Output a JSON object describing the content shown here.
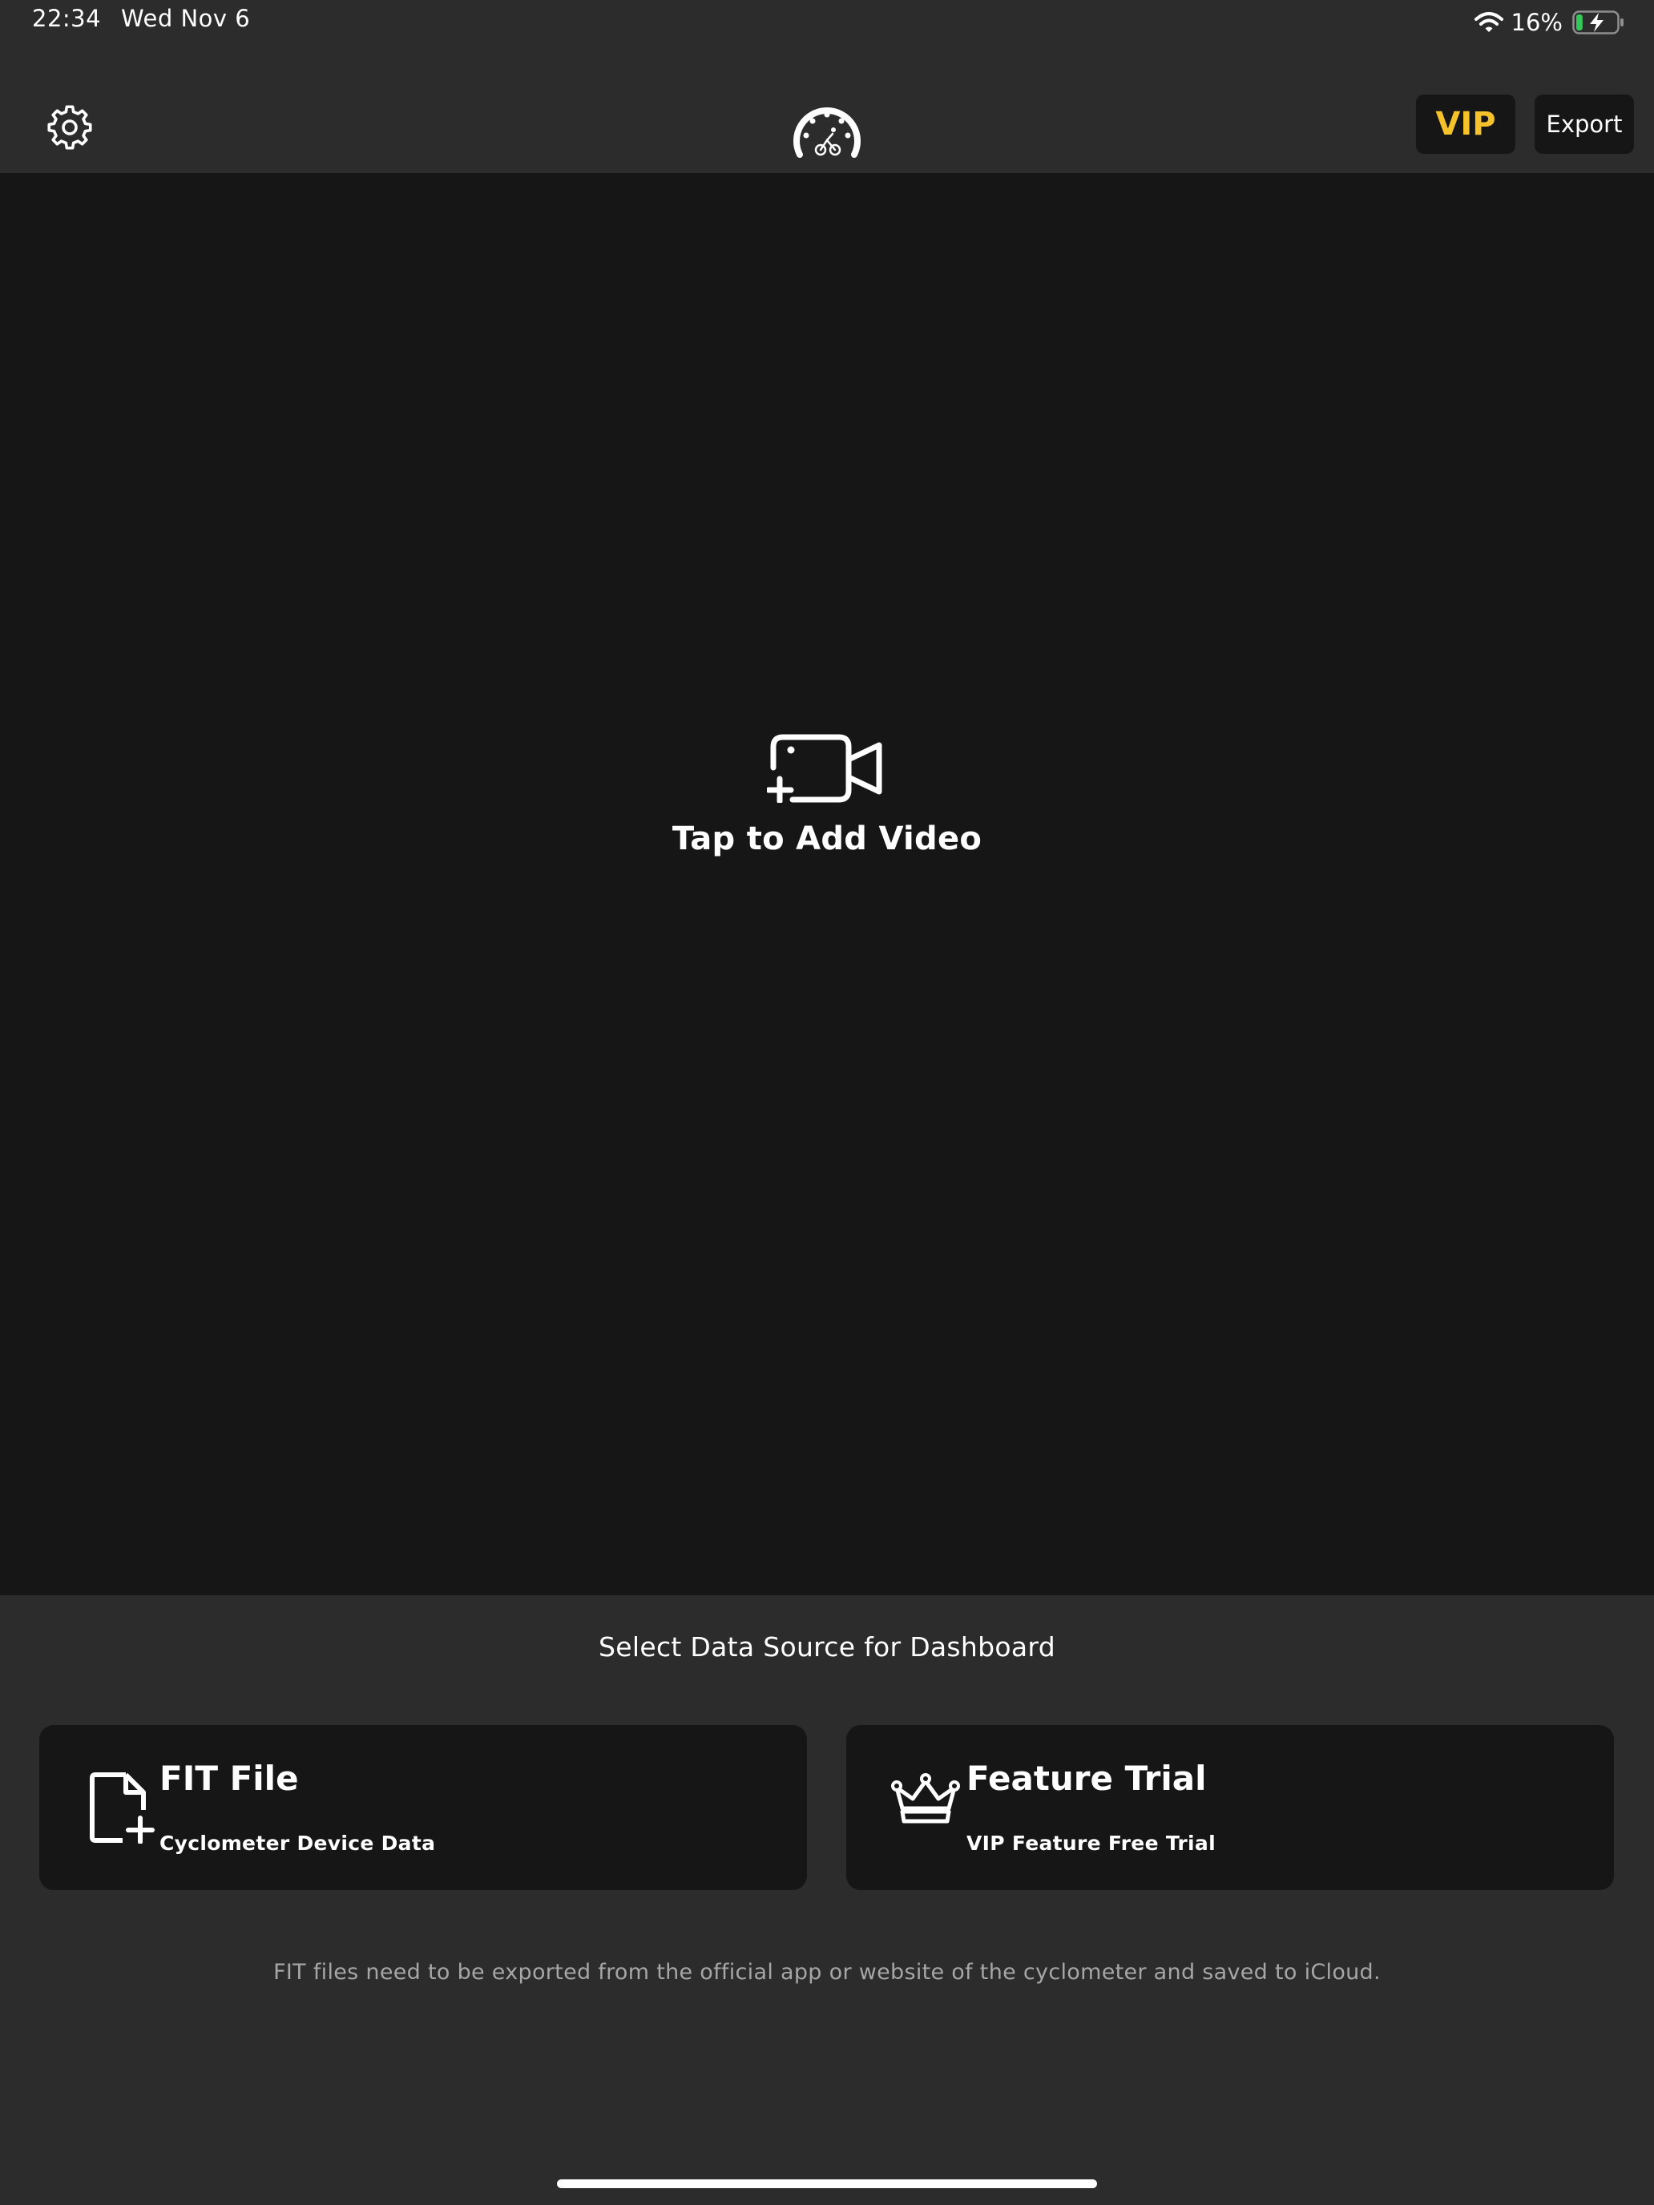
{
  "status_bar": {
    "time": "22:34",
    "date": "Wed Nov 6",
    "battery_percent": "16%",
    "battery_level": 0.16,
    "charging": true
  },
  "top_nav": {
    "settings_icon": "gear-icon",
    "logo_icon": "speedometer-cyclist-icon",
    "vip_label": "VIP",
    "export_label": "Export"
  },
  "video": {
    "add_icon": "video-camera-add-icon",
    "add_label": "Tap to Add Video"
  },
  "data_source": {
    "title": "Select Data Source for Dashboard",
    "cards": [
      {
        "icon": "file-add-icon",
        "title": "FIT File",
        "subtitle": "Cyclometer Device Data"
      },
      {
        "icon": "crown-icon",
        "title": "Feature Trial",
        "subtitle": "VIP Feature Free Trial"
      }
    ],
    "footnote": "FIT files need to be exported from the official app or website of the cyclometer and saved to iCloud."
  },
  "colors": {
    "background": "#2c2c2d",
    "panel": "#161616",
    "vip_gold": "#f5c22b",
    "battery_green": "#34c759",
    "muted_text": "#a6a6a6"
  }
}
